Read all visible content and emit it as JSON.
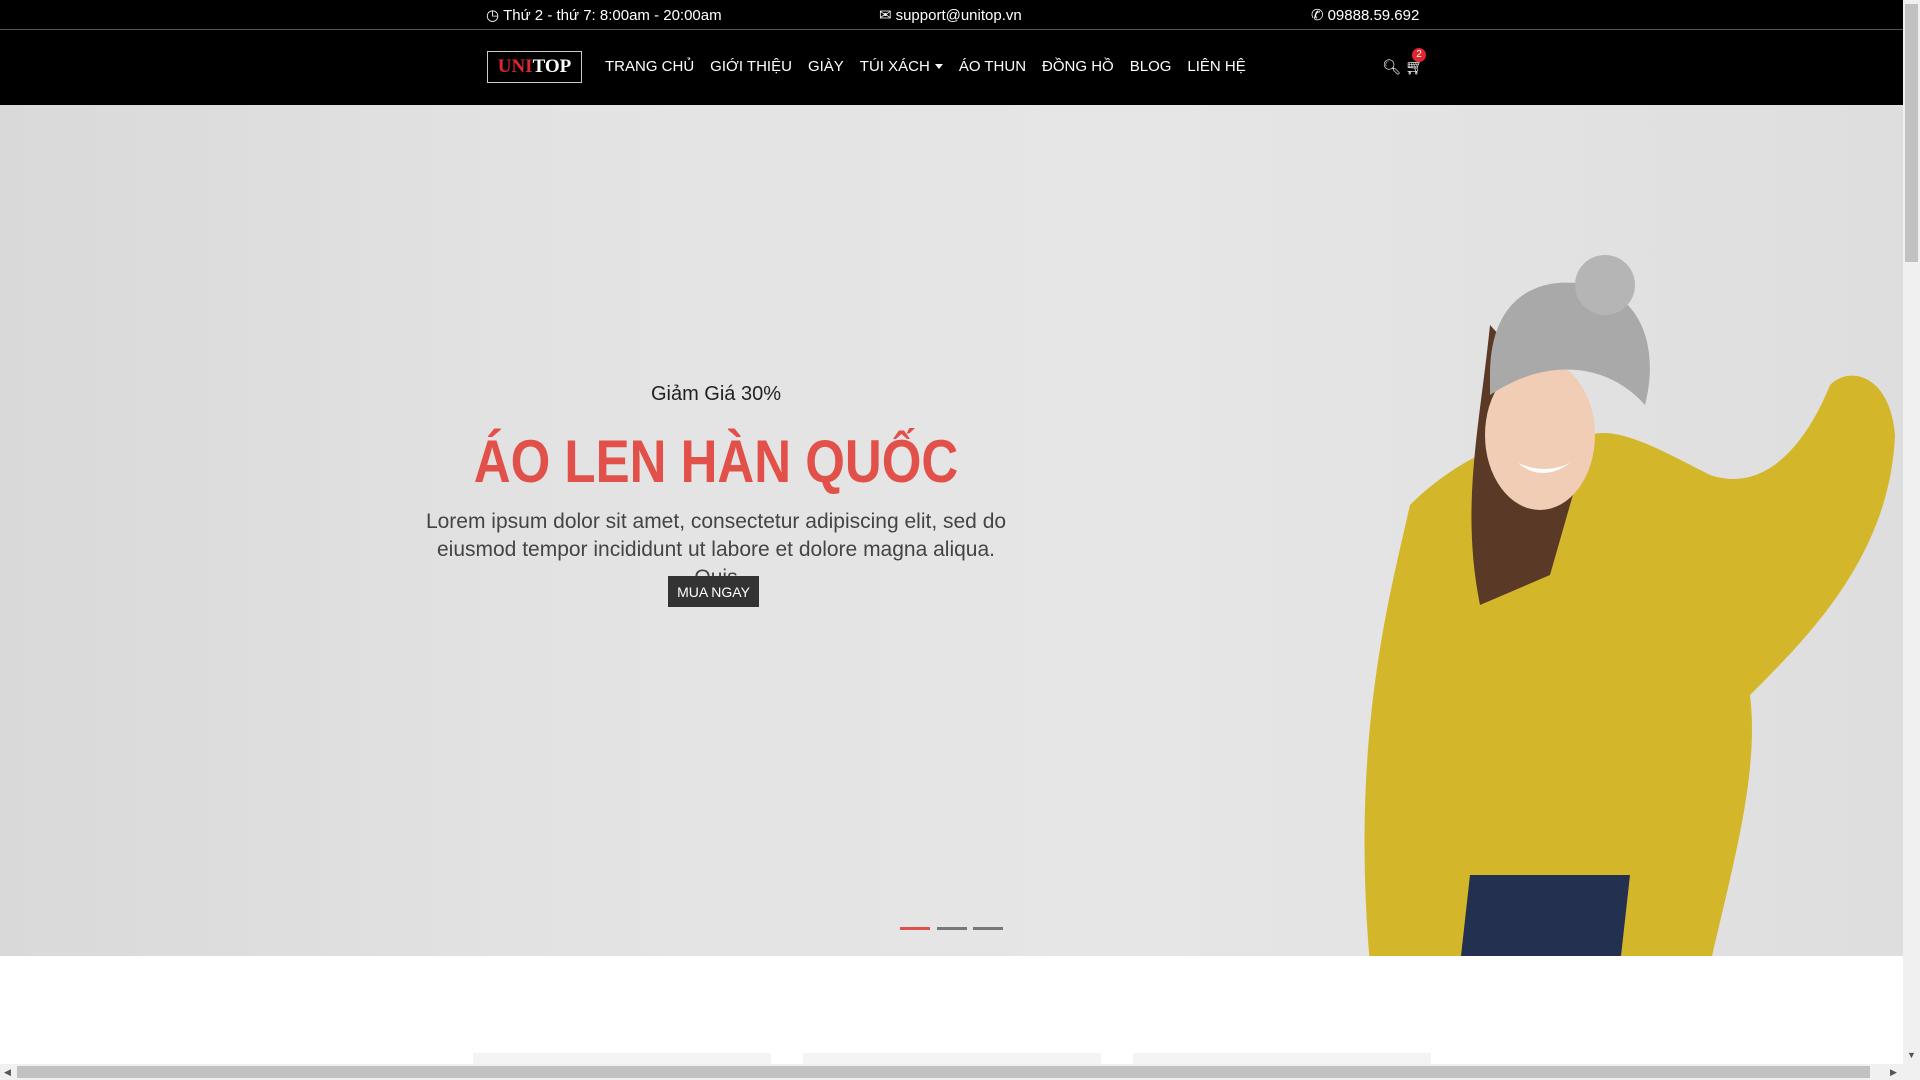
{
  "topbar": {
    "hours": "Thứ 2 - thứ 7: 8:00am - 20:00am",
    "email": "support@unitop.vn",
    "phone": "09888.59.692"
  },
  "logo": {
    "part1": "UNI",
    "part2": "TOP"
  },
  "menu": [
    "TRANG CHỦ",
    "GIỚI THIỆU",
    "GIÀY",
    "TÚI XÁCH",
    "ÁO THUN",
    "ĐỒNG HỒ",
    "BLOG",
    "LIÊN HỆ"
  ],
  "cart": {
    "count": "2"
  },
  "hero": {
    "subtitle": "Giảm Giá 30%",
    "title": "ÁO LEN HÀN QUỐC",
    "description": "Lorem ipsum dolor sit amet, consectetur adipiscing elit, sed do eiusmod tempor incididunt ut labore et dolore magna aliqua. Quis",
    "button": "MUA NGAY",
    "active_slide": 1,
    "slides": 3
  },
  "colors": {
    "accent": "#e2504a",
    "brand_red": "#e0262e",
    "bar": "#000000"
  }
}
